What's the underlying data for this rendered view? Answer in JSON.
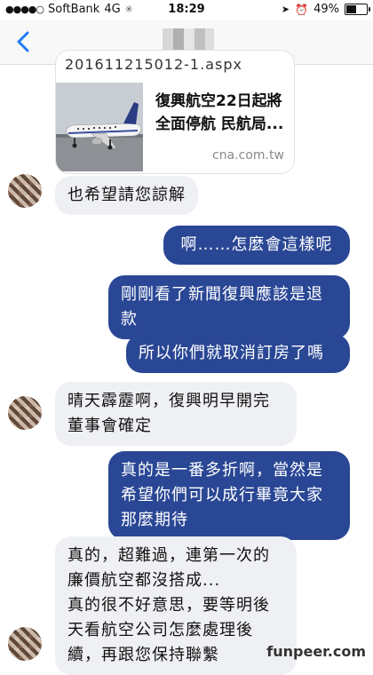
{
  "status_bar": {
    "carrier": "SoftBank",
    "network": "4G",
    "time": "18:29",
    "battery": "49%",
    "battery_level": 0.49
  },
  "nav": {
    "back_icon": "chevron-left-icon"
  },
  "link_card": {
    "url": "201611215012-1.aspx",
    "title_line1": "復興航空22日起將",
    "title_line2": "全面停航 民航局...",
    "domain": "cna.com.tw"
  },
  "messages": [
    {
      "side": "in",
      "text": "也希望請您諒解"
    },
    {
      "side": "out",
      "text": "啊……怎麼會這樣呢"
    },
    {
      "side": "out",
      "lines": [
        "剛剛看了新聞復興應該是退",
        "款"
      ]
    },
    {
      "side": "out",
      "text": "所以你們就取消訂房了嗎"
    },
    {
      "side": "in",
      "lines": [
        "晴天霹靂啊，復興明早開完",
        "董事會確定"
      ]
    },
    {
      "side": "out",
      "lines": [
        "真的是一番多折啊，當然是",
        "希望你們可以成行畢竟大家",
        "那麼期待"
      ]
    },
    {
      "side": "in",
      "lines": [
        "真的，超難過，連第一次的",
        "廉價航空都沒搭成...",
        "真的很不好意思，要等明後",
        "天看航空公司怎麼處理後",
        "續，再跟您保持聯繫"
      ]
    }
  ],
  "watermark": "funpeer.com",
  "colors": {
    "outgoing_bubble": "#2a4795",
    "incoming_bubble": "#eef0f3",
    "back_arrow": "#1f7cf7"
  }
}
